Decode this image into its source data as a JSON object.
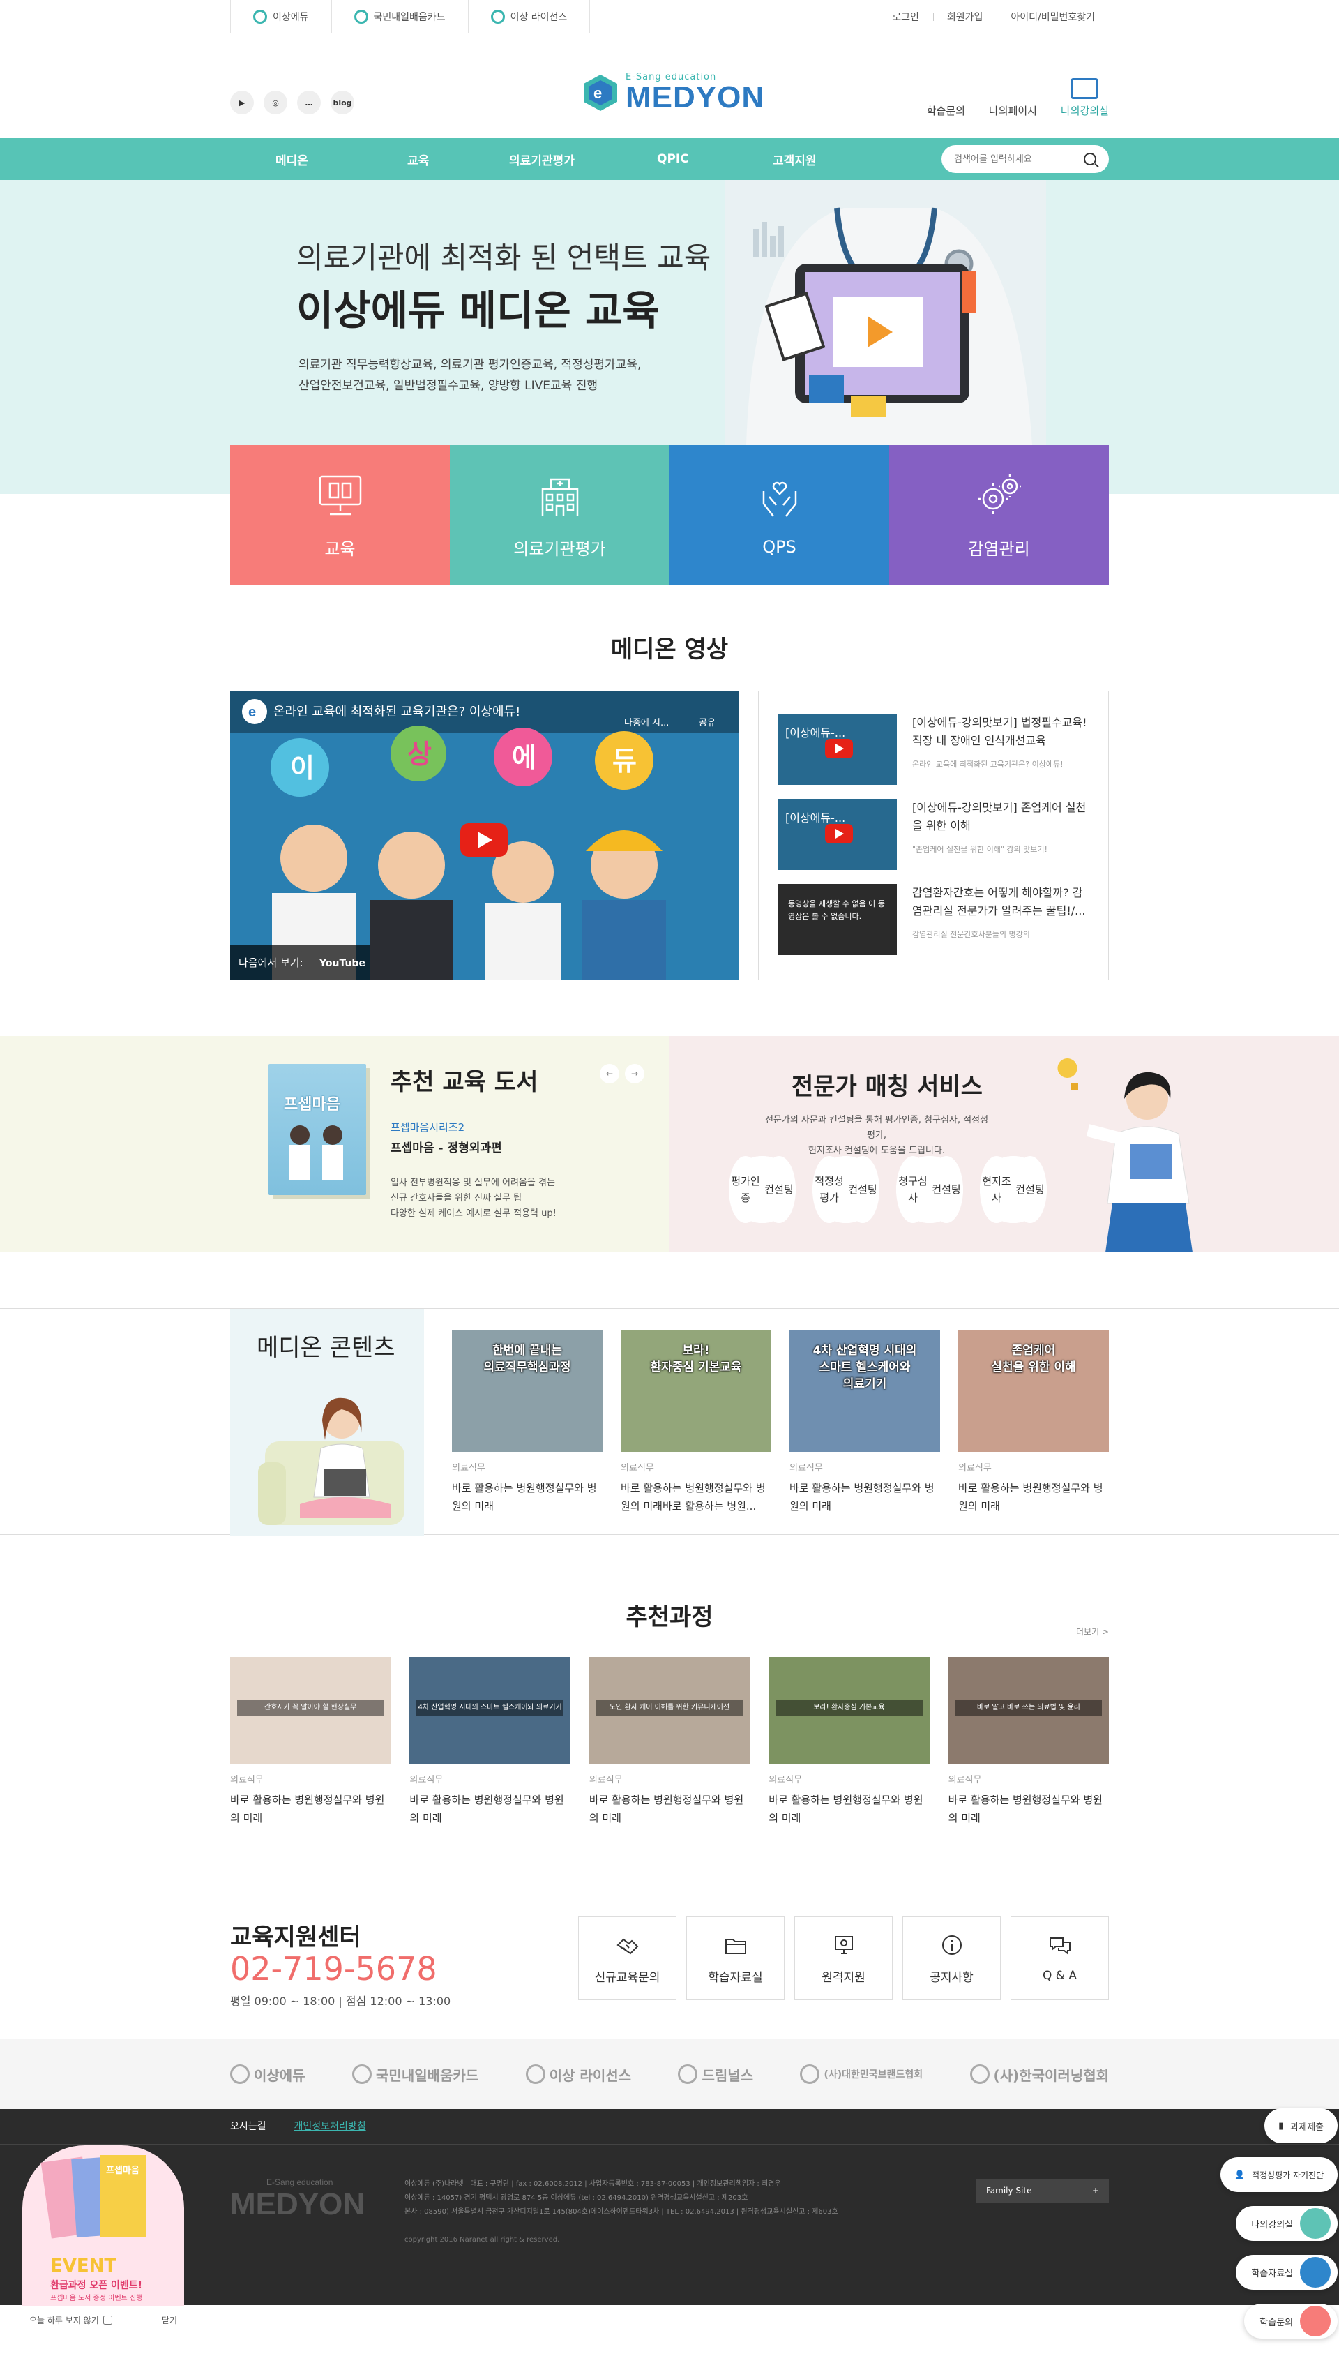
{
  "topbar": {
    "tabs": [
      "이상에듀",
      "국민내일배움카드",
      "이상 라이선스"
    ],
    "links": [
      "로그인",
      "회원가입",
      "아이디/비밀번호찾기"
    ]
  },
  "header": {
    "sns": [
      "blog"
    ],
    "logo_small": "E-Sang education",
    "logo": "MEDYON",
    "menu": [
      "학습문의",
      "나의페이지",
      "나의강의실"
    ]
  },
  "nav": {
    "items": [
      "메디온",
      "교육",
      "의료기관평가",
      "QPIC",
      "고객지원"
    ],
    "search_placeholder": "검색어를 입력하세요"
  },
  "hero": {
    "subtitle": "의료기관에 최적화 된 언택트 교육",
    "title": "이상에듀 메디온 교육",
    "desc1": "의료기관 직무능력향상교육, 의료기관 평가인증교육, 적정성평가교육,",
    "desc2": "산업안전보건교육, 일반법정필수교육, 양방향 LIVE교육 진행"
  },
  "tiles": [
    {
      "label": "교육",
      "color": "#f77c79"
    },
    {
      "label": "의료기관평가",
      "color": "#5ec3b5"
    },
    {
      "label": "QPS",
      "color": "#2e86cc"
    },
    {
      "label": "감염관리",
      "color": "#8560c3"
    }
  ],
  "video": {
    "section_title": "메디온 영상",
    "main_title": "온라인 교육에 최적화된 교육기관은? 이상에듀!",
    "main_later": "나중에 시...",
    "main_share": "공유",
    "main_watch": "다음에서 보기:",
    "main_yt": "YouTube",
    "bubbles": [
      "이",
      "상",
      "에",
      "듀"
    ],
    "items": [
      {
        "thumb": "[이상에듀-...",
        "title": "[이상에듀-강의맛보기] 법정필수교육! 직장 내 장애인 인식개선교육",
        "sub": "온라인 교육에 최적화된 교육기관은? 이상에듀!"
      },
      {
        "thumb": "[이상에듀-...",
        "title": "[이상에듀-강의맛보기] 존엄케어 실천을 위한 이해",
        "sub": "\"존엄케어 실천을 위한 이해\" 강의 맛보기!"
      },
      {
        "thumb": "동영상을 재생할 수 없음\n이 동영상은 볼 수 없습니다.",
        "title": "감염환자간호는 어떻게 해야할까? 감염관리실 전문가가 알려주는 꿀팁!/...",
        "sub": "감염관리실 전문간호사분들의 명강의"
      }
    ]
  },
  "books": {
    "title": "추천 교육 도서",
    "cover": "프셉마음",
    "series": "프셉마음시리즈2",
    "name": "프셉마음 - 정형외과편",
    "desc": [
      "입사 전부병원적응 및 실무에 어려움을 겪는",
      "신규 간호사들을 위한 진짜 실무 팁",
      "다양한 실제 케이스 예시로 실무 적용력 up!"
    ],
    "prev": "←",
    "next": "→"
  },
  "expert": {
    "title": "전문가 매칭 서비스",
    "desc1": "전문가의 자문과 컨설팅을 통해 평가인증, 청구심사, 적정성평가,",
    "desc2": "현지조사 컨설팅에 도움을 드립니다.",
    "circles": [
      [
        "평가인증",
        "컨설팅"
      ],
      [
        "적정성평가",
        "컨설팅"
      ],
      [
        "청구심사",
        "컨설팅"
      ],
      [
        "현지조사",
        "컨설팅"
      ]
    ]
  },
  "contents": {
    "title": "메디온 콘텐츠",
    "cards": [
      {
        "overlay": "한번에 끝내는\n의료직무핵심과정",
        "cat": "의료직무",
        "text": "바로 활용하는 병원행정실무와 병원의 미래",
        "bg": "#8ca0a8"
      },
      {
        "overlay": "보라!\n환자중심 기본교육",
        "cat": "의료직무",
        "text": "바로 활용하는 병원행정실무와 병원의 미래바로 활용하는 병원...",
        "bg": "#93a67a"
      },
      {
        "overlay": "4차 산업혁명 시대의\n스마트 헬스케어와\n의료기기",
        "cat": "의료직무",
        "text": "바로 활용하는 병원행정실무와 병원의 미래",
        "bg": "#6f8fb0"
      },
      {
        "overlay": "존엄케어\n실천을 위한 이해",
        "cat": "의료직무",
        "text": "바로 활용하는 병원행정실무와 병원의 미래",
        "bg": "#c99f8d"
      }
    ]
  },
  "recommend": {
    "title": "추천과정",
    "more": "더보기 >",
    "cards": [
      {
        "overlay": "간호사가 꼭 알아야 할 현장실무",
        "cat": "의료직무",
        "text": "바로 활용하는 병원행정실무와 병원의 미래",
        "bg": "#e6d8cc"
      },
      {
        "overlay": "4차 산업혁명 시대의 스마트 헬스케어와 의료기기",
        "cat": "의료직무",
        "text": "바로 활용하는 병원행정실무와 병원의 미래",
        "bg": "#4a6a86"
      },
      {
        "overlay": "노인 환자 케어 이해를 위한 커뮤니케이션",
        "cat": "의료직무",
        "text": "바로 활용하는 병원행정실무와 병원의 미래",
        "bg": "#b7a99a"
      },
      {
        "overlay": "보라! 환자중심 기본교육",
        "cat": "의료직무",
        "text": "바로 활용하는 병원행정실무와 병원의 미래",
        "bg": "#7d9361"
      },
      {
        "overlay": "바로 알고 바로 쓰는 의료법 및 윤리",
        "cat": "의료직무",
        "text": "바로 활용하는 병원행정실무와 병원의 미래",
        "bg": "#8c7a6d"
      }
    ]
  },
  "support": {
    "title": "교육지원센터",
    "phone": "02-719-5678",
    "hours": "평일 09:00 ~ 18:00  |  점심 12:00 ~ 13:00",
    "boxes": [
      "신규교육문의",
      "학습자료실",
      "원격지원",
      "공지사항",
      "Q & A"
    ]
  },
  "partners": [
    "이상에듀",
    "국민내일배움카드",
    "이상 라이선스",
    "드림널스",
    "(사)대한민국브랜드협회",
    "(사)한국이러닝협회"
  ],
  "footer": {
    "links": [
      "오시는길",
      "개인정보처리방침"
    ],
    "logo_small": "E-Sang education",
    "logo": "MEDYON",
    "info1": "이상에듀 (주)나라넷 | 대표 : 구명란 | fax : 02.6008.2012 | 사업자등록번호 : 783-87-00053 | 개인정보관리책임자 : 최경우",
    "info2": "이상에듀 : 14057) 경기 평택시 광명로 874 5층 이상에듀 (tel : 02.6494.2010) 원격평생교육시설신고 : 제203호",
    "info3": "본사 : 08590) 서울특별시 금천구 가산디지털1로 145(804호)에이스하이엔드타워3차 | TEL : 02.6494.2013 | 원격평생교육시설신고 : 제603호",
    "copyright": "copyright 2016 Naranet all right & reserved.",
    "family": "Family Site",
    "family_plus": "+"
  },
  "floating": {
    "right": [
      "과제제출",
      "적정성평가 자기진단",
      "나의강의실",
      "학습자료실",
      "학습문의"
    ],
    "event_cover": "프셉마음",
    "event_title": "EVENT",
    "event_sub": "환급과정 오픈 이벤트!",
    "event_sub2": "프셉마음 도서 증정 이벤트 진행",
    "today_close": "오늘 하루 보지 않기",
    "close": "닫기"
  }
}
